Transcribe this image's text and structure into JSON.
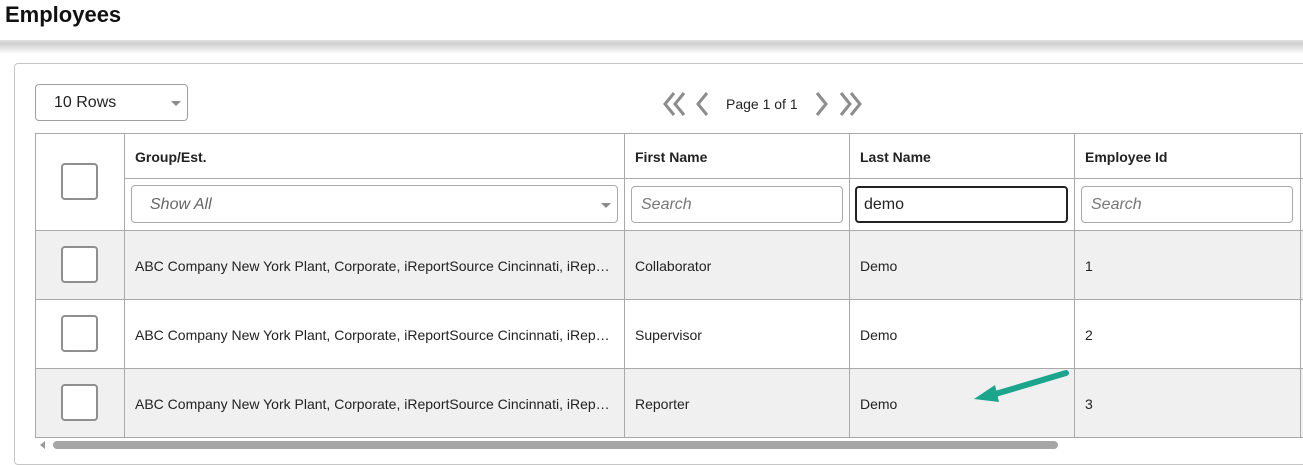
{
  "page": {
    "title": "Employees"
  },
  "toolbar": {
    "rows_select_value": "10 Rows",
    "page_label": "Page 1 of 1"
  },
  "table": {
    "columns": [
      {
        "header": "Group/Est."
      },
      {
        "header": "First Name"
      },
      {
        "header": "Last Name"
      },
      {
        "header": "Employee Id"
      }
    ],
    "filters": {
      "group_select_value": "Show All",
      "first_name": {
        "value": "",
        "placeholder": "Search"
      },
      "last_name": {
        "value": "demo",
        "placeholder": "Search"
      },
      "employee_id": {
        "value": "",
        "placeholder": "Search"
      }
    },
    "rows": [
      {
        "group": "ABC Company New York Plant, Corporate, iReportSource Cincinnati, iReportSource Columbus",
        "first_name": "Collaborator",
        "last_name": "Demo",
        "employee_id": "1"
      },
      {
        "group": "ABC Company New York Plant, Corporate, iReportSource Cincinnati, iReportSource Columbus",
        "first_name": "Supervisor",
        "last_name": "Demo",
        "employee_id": "2"
      },
      {
        "group": "ABC Company New York Plant, Corporate, iReportSource Cincinnati, iReportSource Columbus",
        "first_name": "Reporter",
        "last_name": "Demo",
        "employee_id": "3"
      }
    ]
  },
  "colors": {
    "annotation_arrow": "#1aa58c",
    "row_shaded": "#f0f0f0",
    "grid_line": "#a9a9a9"
  }
}
